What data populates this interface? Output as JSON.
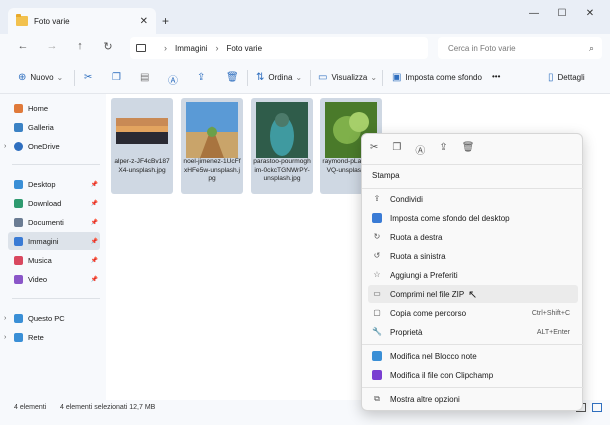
{
  "window": {
    "tab_title": "Foto varie",
    "new_tab": "+"
  },
  "window_controls": [
    "—",
    "☐",
    "✕"
  ],
  "nav": {
    "back": "←",
    "forward": "→",
    "up": "↑",
    "refresh": "↻",
    "breadcrumb": [
      "Immagini",
      "Foto varie"
    ],
    "search_placeholder": "Cerca in Foto varie"
  },
  "toolbar": {
    "new_label": "Nuovo",
    "sort_label": "Ordina",
    "view_label": "Visualizza",
    "wallpaper_label": "Imposta come sfondo",
    "more": "•••",
    "details_label": "Dettagli"
  },
  "sidebar": {
    "items": [
      {
        "label": "Home",
        "color": "#e07a3a"
      },
      {
        "label": "Galleria",
        "color": "#3b82c4"
      },
      {
        "label": "OneDrive",
        "color": "#2f6fbf"
      },
      {
        "label": "Desktop",
        "color": "#3a8fd6"
      },
      {
        "label": "Download",
        "color": "#2e9a6f"
      },
      {
        "label": "Documenti",
        "color": "#6b7c93"
      },
      {
        "label": "Immagini",
        "color": "#3a7bd5"
      },
      {
        "label": "Musica",
        "color": "#d9485f"
      },
      {
        "label": "Video",
        "color": "#8a56c8"
      },
      {
        "label": "Questo PC",
        "color": "#3a8fd6"
      },
      {
        "label": "Rete",
        "color": "#3a8fd6"
      }
    ]
  },
  "files": [
    {
      "name": "alper-z-JF4cBv187X4-unsplash.jpg"
    },
    {
      "name": "noel-jimenez-1UcFfxHFe5w-unsplash.jpg"
    },
    {
      "name": "parastoo-pourmoghim-0ckcTGNWrPY-unsplash.jpg"
    },
    {
      "name": "raymond-pLa5PLINVQ-unsplash.jpg"
    }
  ],
  "status": {
    "count": "4 elementi",
    "selected": "4 elementi selezionati  12,7 MB"
  },
  "context_menu": {
    "top_icons": [
      "cut-icon",
      "copy-icon",
      "rename-icon",
      "share-icon",
      "delete-icon"
    ],
    "items": [
      {
        "label": "Stampa",
        "shortcut": ""
      },
      {
        "label": "Condividi",
        "shortcut": ""
      },
      {
        "label": "Imposta come sfondo del desktop",
        "shortcut": ""
      },
      {
        "label": "Ruota a destra",
        "shortcut": ""
      },
      {
        "label": "Ruota a sinistra",
        "shortcut": ""
      },
      {
        "label": "Aggiungi a Preferiti",
        "shortcut": ""
      },
      {
        "label": "Comprimi nel file ZIP",
        "shortcut": ""
      },
      {
        "label": "Copia come percorso",
        "shortcut": "Ctrl+Shift+C"
      },
      {
        "label": "Proprietà",
        "shortcut": "ALT+Enter"
      },
      {
        "label": "Modifica nel Blocco note",
        "shortcut": ""
      },
      {
        "label": "Modifica il file con Clipchamp",
        "shortcut": ""
      },
      {
        "label": "Mostra altre opzioni",
        "shortcut": ""
      }
    ]
  }
}
